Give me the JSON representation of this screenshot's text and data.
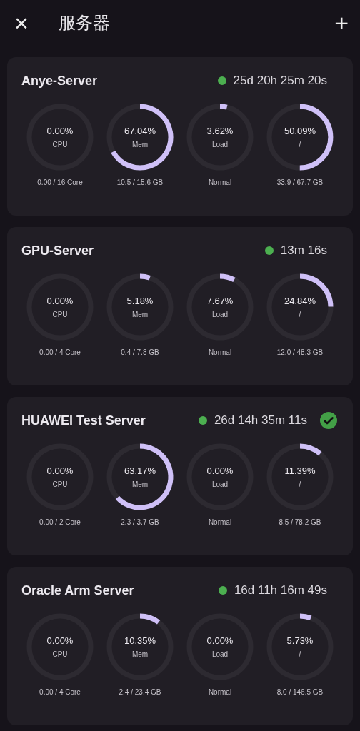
{
  "header": {
    "title": "服务器",
    "close_icon": "×",
    "add_icon": "+"
  },
  "servers": [
    {
      "name": "Anye-Server",
      "uptime": "25d 20h 25m 20s",
      "verified": false,
      "gauges": [
        {
          "value": "0.00%",
          "label": "CPU",
          "detail": "0.00 / 16 Core"
        },
        {
          "value": "67.04%",
          "label": "Mem",
          "detail": "10.5 / 15.6 GB"
        },
        {
          "value": "3.62%",
          "label": "Load",
          "detail": "Normal"
        },
        {
          "value": "50.09%",
          "label": "/",
          "detail": "33.9 / 67.7 GB"
        }
      ]
    },
    {
      "name": "GPU-Server",
      "uptime": "13m 16s",
      "verified": false,
      "gauges": [
        {
          "value": "0.00%",
          "label": "CPU",
          "detail": "0.00 / 4 Core"
        },
        {
          "value": "5.18%",
          "label": "Mem",
          "detail": "0.4 / 7.8 GB"
        },
        {
          "value": "7.67%",
          "label": "Load",
          "detail": "Normal"
        },
        {
          "value": "24.84%",
          "label": "/",
          "detail": "12.0 / 48.3 GB"
        }
      ]
    },
    {
      "name": "HUAWEI Test Server",
      "uptime": "26d 14h 35m 11s",
      "verified": true,
      "gauges": [
        {
          "value": "0.00%",
          "label": "CPU",
          "detail": "0.00 / 2 Core"
        },
        {
          "value": "63.17%",
          "label": "Mem",
          "detail": "2.3 / 3.7 GB"
        },
        {
          "value": "0.00%",
          "label": "Load",
          "detail": "Normal"
        },
        {
          "value": "11.39%",
          "label": "/",
          "detail": "8.5 / 78.2 GB"
        }
      ]
    },
    {
      "name": "Oracle Arm Server",
      "uptime": "16d 11h 16m 49s",
      "verified": false,
      "gauges": [
        {
          "value": "0.00%",
          "label": "CPU",
          "detail": "0.00 / 4 Core"
        },
        {
          "value": "10.35%",
          "label": "Mem",
          "detail": "2.4 / 23.4 GB"
        },
        {
          "value": "0.00%",
          "label": "Load",
          "detail": "Normal"
        },
        {
          "value": "5.73%",
          "label": "/",
          "detail": "8.0 / 146.5 GB"
        }
      ]
    }
  ]
}
